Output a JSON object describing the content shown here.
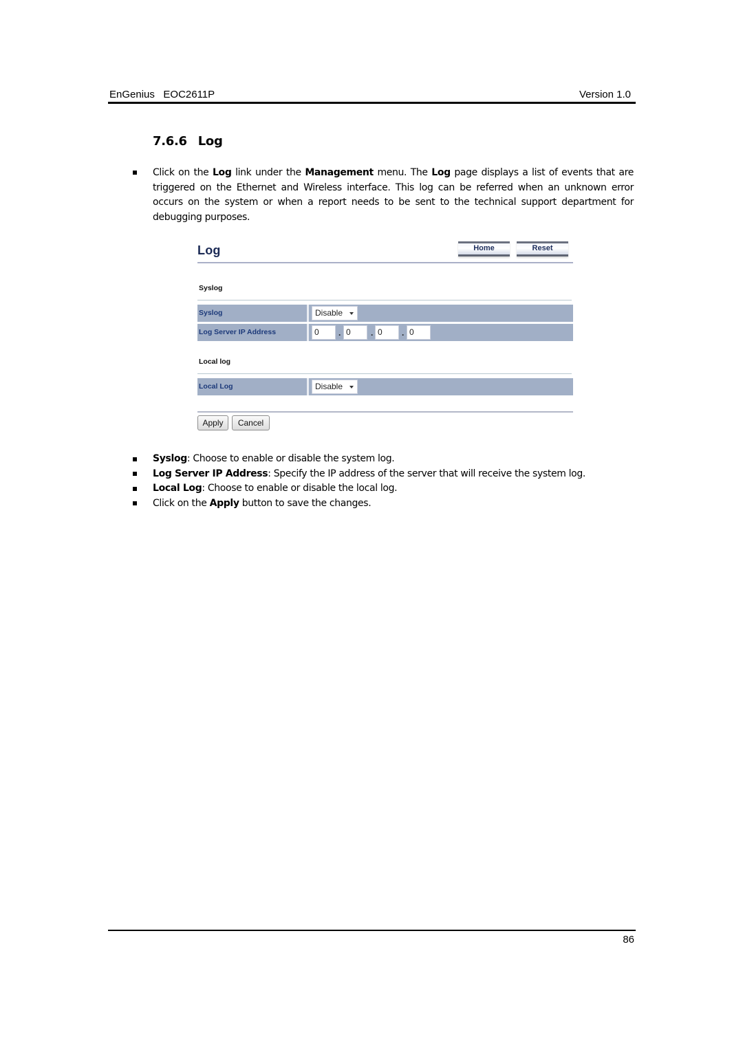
{
  "header": {
    "brand": "EnGenius",
    "model": "EOC2611P",
    "version": "Version 1.0"
  },
  "section": {
    "number": "7.6.6",
    "title": "Log"
  },
  "intro": {
    "t1": "Click on the ",
    "b1": "Log",
    "t2": " link under the ",
    "b2": "Management",
    "t3": " menu. The ",
    "b3": "Log",
    "t4": " page displays a list of events that are triggered on the Ethernet and Wireless interface. This log can be referred when an unknown error occurs on the system or when a report needs to be sent to the technical support department for debugging purposes."
  },
  "ui": {
    "title": "Log",
    "home_button": "Home",
    "reset_button": "Reset",
    "syslog_section": "Syslog",
    "syslog_label": "Syslog",
    "syslog_value": "Disable",
    "log_server_label": "Log Server IP Address",
    "ip": [
      "0",
      "0",
      "0",
      "0"
    ],
    "ip_separator": ".",
    "local_section": "Local log",
    "local_label": "Local Log",
    "local_value": "Disable",
    "apply_button": "Apply",
    "cancel_button": "Cancel",
    "colors": {
      "row_bg": "#a1afc6",
      "label_text": "#1d3a7a",
      "title_text": "#1b2a55"
    }
  },
  "descriptions": [
    {
      "bold": "Syslog",
      "text": ": Choose to enable or disable the system log."
    },
    {
      "bold": "Log Server IP Address",
      "text": ": Specify the IP address of the server that will receive the system log."
    },
    {
      "bold": "Local Log",
      "text": ": Choose to enable or disable the local log."
    },
    {
      "pre": "Click on the ",
      "bold": "Apply",
      "text": " button to save the changes."
    }
  ],
  "footer": {
    "page_number": "86"
  }
}
